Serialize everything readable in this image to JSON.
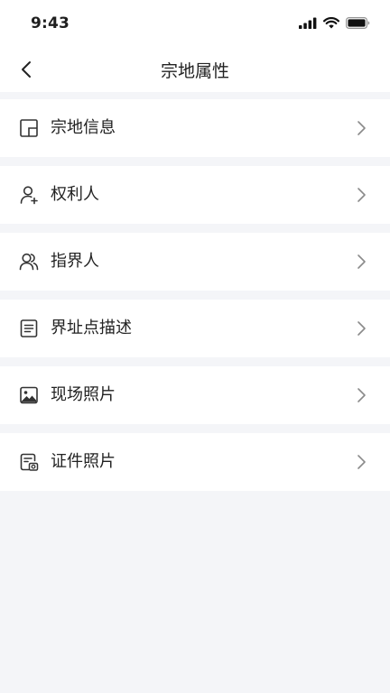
{
  "status_bar": {
    "time": "9:43"
  },
  "header": {
    "title": "宗地属性"
  },
  "menu": {
    "items": [
      {
        "label": "宗地信息",
        "icon": "parcel-info-icon"
      },
      {
        "label": "权利人",
        "icon": "user-add-icon"
      },
      {
        "label": "指界人",
        "icon": "users-icon"
      },
      {
        "label": "界址点描述",
        "icon": "document-list-icon"
      },
      {
        "label": "现场照片",
        "icon": "image-icon"
      },
      {
        "label": "证件照片",
        "icon": "id-photo-icon"
      }
    ]
  },
  "colors": {
    "background": "#f4f5f8",
    "card": "#ffffff",
    "text": "#222222",
    "icon": "#333333",
    "chevron": "#8a8a8a"
  }
}
